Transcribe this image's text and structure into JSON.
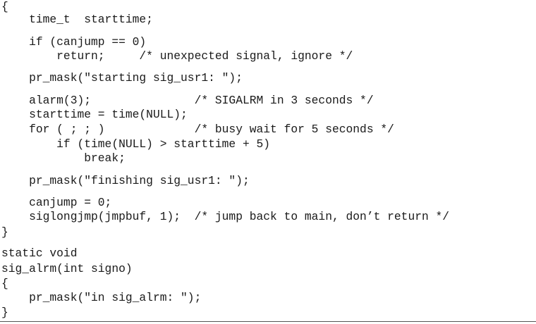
{
  "code": {
    "lines": [
      "{",
      "    time_t  starttime;",
      "    if (canjump == 0)",
      "        return;     /* unexpected signal, ignore */",
      "    pr_mask(\"starting sig_usr1: \");",
      "    alarm(3);               /* SIGALRM in 3 seconds */",
      "    starttime = time(NULL);",
      "    for ( ; ; )             /* busy wait for 5 seconds */",
      "        if (time(NULL) > starttime + 5)",
      "            break;",
      "    pr_mask(\"finishing sig_usr1: \");",
      "    canjump = 0;",
      "    siglongjmp(jmpbuf, 1);  /* jump back to main, don’t return */",
      "}",
      "static void",
      "sig_alrm(int signo)",
      "{",
      "    pr_mask(\"in sig_alrm: \");",
      "}"
    ]
  }
}
